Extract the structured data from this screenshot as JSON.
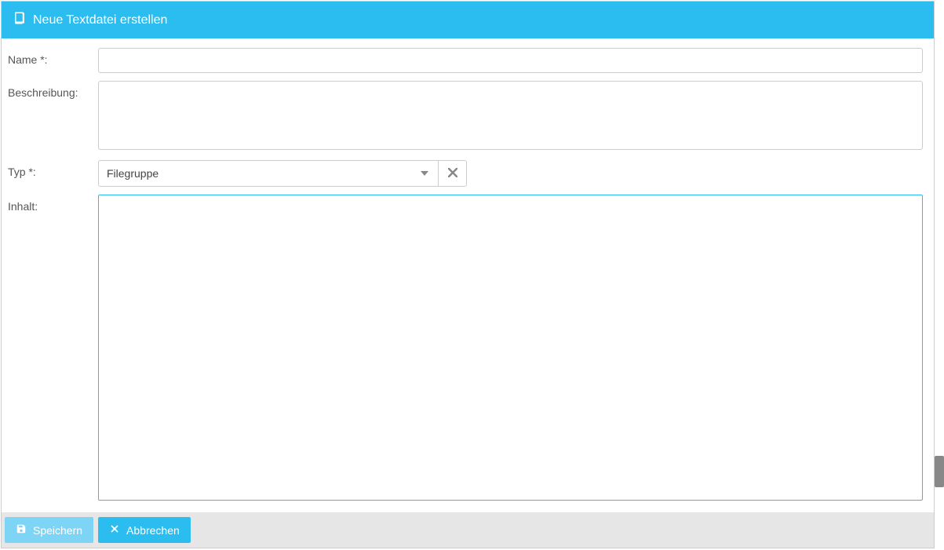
{
  "header": {
    "title": "Neue Textdatei erstellen"
  },
  "form": {
    "name": {
      "label": "Name *:",
      "value": ""
    },
    "description": {
      "label": "Beschreibung:",
      "value": ""
    },
    "type": {
      "label": "Typ *:",
      "selected": "Filegruppe"
    },
    "content": {
      "label": "Inhalt:",
      "value": ""
    }
  },
  "footer": {
    "save": "Speichern",
    "cancel": "Abbrechen"
  }
}
